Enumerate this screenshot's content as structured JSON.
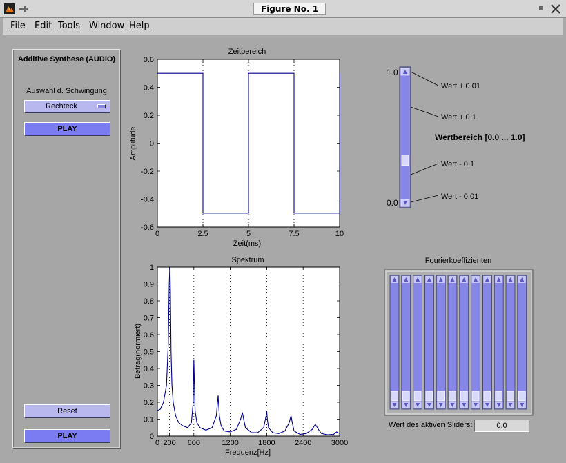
{
  "window": {
    "title": "Figure No. 1"
  },
  "menu": [
    "File",
    "Edit",
    "Tools",
    "Window",
    "Help"
  ],
  "panel": {
    "title": "Additive Synthese (AUDIO)",
    "waveform_label": "Auswahl d. Schwingung",
    "waveform_selected": "Rechteck",
    "play_top": "PLAY",
    "reset": "Reset",
    "play_bottom": "PLAY"
  },
  "slider_help": {
    "top_value": "1.0",
    "bottom_value": "0.0",
    "range_label": "Wertbereich [0.0 ... 1.0]",
    "annotations": [
      "Wert + 0.01",
      "Wert + 0.1",
      "Wert - 0.1",
      "Wert - 0.01"
    ],
    "position": 0.3
  },
  "fourier": {
    "title": "Fourierkoeffizienten",
    "slider_count": 12,
    "active_label": "Wert des aktiven Sliders:",
    "active_value": "0.0"
  },
  "colors": {
    "accent": "#7b7bf2",
    "light": "#b8b8ef",
    "line": "#00008b"
  },
  "chart_data": [
    {
      "type": "line",
      "title": "Zeitbereich",
      "xlabel": "Zeit(ms)",
      "ylabel": "Amplitude",
      "xlim": [
        0,
        10
      ],
      "ylim": [
        -0.6,
        0.6
      ],
      "xticks": [
        0,
        2.5,
        5,
        7.5,
        10
      ],
      "xtick_labels": [
        "0",
        "2.5",
        "5",
        "7.5",
        "10"
      ],
      "yticks": [
        -0.6,
        -0.4,
        -0.2,
        0,
        0.2,
        0.4,
        0.6
      ],
      "ytick_labels": [
        "-0.6",
        "-0.4",
        "-0.2",
        "0",
        "0.2",
        "0.4",
        "0.6"
      ],
      "vlines": [
        2.5,
        5,
        7.5,
        10
      ],
      "x": [
        0,
        2.5,
        2.5,
        5,
        5,
        7.5,
        7.5,
        10,
        10
      ],
      "y": [
        0.5,
        0.5,
        -0.5,
        -0.5,
        0.5,
        0.5,
        -0.5,
        -0.5,
        0.5
      ]
    },
    {
      "type": "line",
      "title": "Spektrum",
      "xlabel": "Frequenz[Hz]",
      "ylabel": "Betrag(normiert)",
      "xlim": [
        0,
        3000
      ],
      "ylim": [
        0,
        1
      ],
      "xticks": [
        0,
        200,
        600,
        1200,
        1800,
        2400,
        3000
      ],
      "xtick_labels": [
        "0",
        "200",
        "600",
        "1200",
        "1800",
        "2400",
        "3000"
      ],
      "yticks": [
        0,
        0.1,
        0.2,
        0.3,
        0.4,
        0.5,
        0.6,
        0.7,
        0.8,
        0.9,
        1
      ],
      "ytick_labels": [
        "0",
        "0.1",
        "0.2",
        "0.3",
        "0.4",
        "0.5",
        "0.6",
        "0.7",
        "0.8",
        "0.9",
        "1"
      ],
      "vlines": [
        200,
        600,
        1200,
        1800,
        2400
      ],
      "x": [
        0,
        50,
        100,
        150,
        180,
        195,
        205,
        210,
        215,
        225,
        240,
        260,
        300,
        350,
        420,
        500,
        560,
        590,
        600,
        610,
        620,
        650,
        700,
        800,
        900,
        970,
        1000,
        1020,
        1050,
        1100,
        1200,
        1300,
        1370,
        1400,
        1420,
        1450,
        1550,
        1650,
        1750,
        1790,
        1800,
        1810,
        1830,
        1900,
        2000,
        2100,
        2170,
        2200,
        2220,
        2250,
        2350,
        2450,
        2550,
        2600,
        2650,
        2700,
        2800,
        2900,
        2950,
        3000
      ],
      "y": [
        0.15,
        0.16,
        0.2,
        0.3,
        0.55,
        0.9,
        1.0,
        0.95,
        0.85,
        0.5,
        0.3,
        0.2,
        0.12,
        0.08,
        0.06,
        0.05,
        0.08,
        0.2,
        0.45,
        0.3,
        0.15,
        0.08,
        0.05,
        0.035,
        0.05,
        0.12,
        0.24,
        0.12,
        0.06,
        0.03,
        0.025,
        0.04,
        0.1,
        0.14,
        0.1,
        0.05,
        0.02,
        0.02,
        0.05,
        0.12,
        0.15,
        0.1,
        0.05,
        0.02,
        0.015,
        0.03,
        0.08,
        0.12,
        0.08,
        0.03,
        0.01,
        0.015,
        0.04,
        0.07,
        0.04,
        0.015,
        0.008,
        0.01,
        0.025,
        0.015
      ]
    }
  ]
}
